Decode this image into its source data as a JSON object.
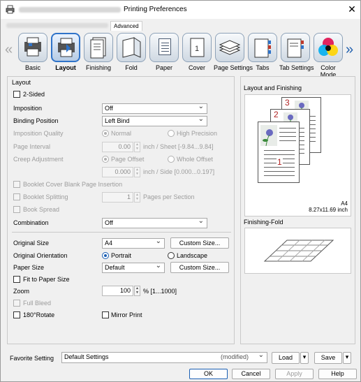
{
  "window": {
    "title": "Printing Preferences",
    "close_label": "✕"
  },
  "top_tabs": {
    "advanced": "Advanced"
  },
  "tabs": [
    {
      "label": "Basic"
    },
    {
      "label": "Layout"
    },
    {
      "label": "Finishing"
    },
    {
      "label": "Fold"
    },
    {
      "label": "Paper"
    },
    {
      "label": "Cover"
    },
    {
      "label": "Page Settings"
    },
    {
      "label": "Tabs"
    },
    {
      "label": "Tab Settings"
    },
    {
      "label": "Color Mode"
    }
  ],
  "nav": {
    "prev": "«",
    "next": "»"
  },
  "layout_panel": {
    "title": "Layout",
    "two_sided": "2-Sided",
    "imposition": {
      "label": "Imposition",
      "value": "Off"
    },
    "binding_position": {
      "label": "Binding Position",
      "value": "Left Bind"
    },
    "imposition_quality": {
      "label": "Imposition Quality",
      "normal": "Normal",
      "high": "High Precision"
    },
    "page_interval": {
      "label": "Page Interval",
      "value": "0.00",
      "unit": "inch / Sheet [-9.84...9.84]"
    },
    "creep_adjustment": {
      "label": "Creep Adjustment",
      "page_offset": "Page Offset",
      "whole_offset": "Whole Offset",
      "value": "0.000",
      "unit": "inch / Side [0.000...0.197]"
    },
    "booklet_cover": "Booklet Cover Blank Page Insertion",
    "booklet_splitting": {
      "label": "Booklet Splitting",
      "value": "1",
      "unit": "Pages per Section"
    },
    "book_spread": "Book Spread",
    "combination": {
      "label": "Combination",
      "value": "Off"
    },
    "original_size": {
      "label": "Original Size",
      "value": "A4",
      "button": "Custom Size..."
    },
    "original_orientation": {
      "label": "Original Orientation",
      "portrait": "Portrait",
      "landscape": "Landscape"
    },
    "paper_size": {
      "label": "Paper Size",
      "value": "Default",
      "button": "Custom Size..."
    },
    "fit_to_paper": "Fit to Paper Size",
    "zoom": {
      "label": "Zoom",
      "value": "100",
      "unit": "% [1...1000]"
    },
    "full_bleed": "Full Bleed",
    "rotate_180": "180°Rotate",
    "mirror_print": "Mirror Print"
  },
  "right_panel": {
    "layout_finishing_title": "Layout and Finishing",
    "page_numbers": [
      "1",
      "2",
      "3"
    ],
    "paper_name": "A4",
    "paper_dims": "8.27x11.69 inch",
    "finishing_fold_title": "Finishing-Fold"
  },
  "favorite": {
    "label": "Favorite Setting",
    "value": "Default Settings",
    "modified": "(modified)",
    "load": "Load",
    "save": "Save"
  },
  "dialog_buttons": {
    "ok": "OK",
    "cancel": "Cancel",
    "apply": "Apply",
    "help": "Help"
  },
  "colors": {
    "accent": "#1a5fb4",
    "page_number": "#b02323"
  }
}
